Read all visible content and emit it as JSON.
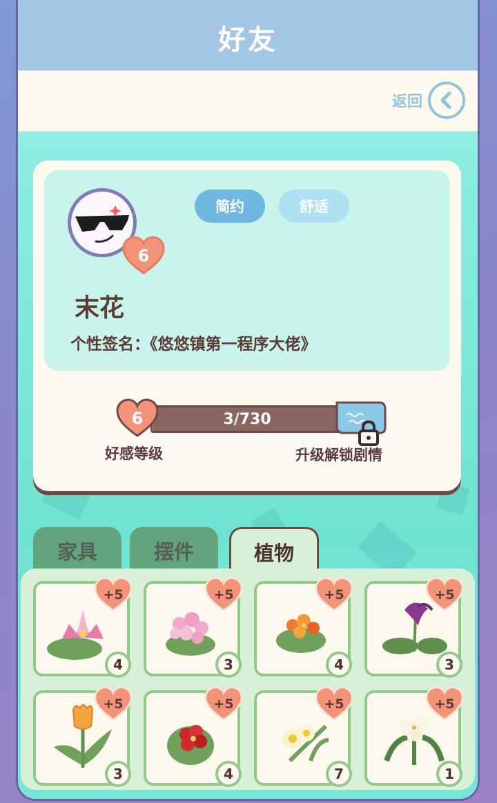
{
  "header": {
    "title": "好友"
  },
  "back": {
    "label": "返回",
    "icon": "chevron-left-icon"
  },
  "profile": {
    "level": "6",
    "name": "末花",
    "signature": "个性签名：《悠悠镇第一程序大佬》",
    "tags": [
      "简约",
      "舒适"
    ]
  },
  "affinity": {
    "level": "6",
    "progress_text": "3/730",
    "progress_current": 3,
    "progress_max": 730,
    "level_label": "好感等级",
    "unlock_label": "升级解锁剧情",
    "unlock_icon": "lock-icon"
  },
  "tabs": [
    {
      "label": "家具",
      "active": false
    },
    {
      "label": "摆件",
      "active": false
    },
    {
      "label": "植物",
      "active": true
    }
  ],
  "items": [
    {
      "icon": "lotus-icon",
      "bonus": "+5",
      "count": "4"
    },
    {
      "icon": "pink-hydrangea-icon",
      "bonus": "+5",
      "count": "3"
    },
    {
      "icon": "orange-flower-icon",
      "bonus": "+5",
      "count": "4"
    },
    {
      "icon": "purple-orchid-icon",
      "bonus": "+5",
      "count": "3"
    },
    {
      "icon": "tulip-icon",
      "bonus": "+5",
      "count": "3"
    },
    {
      "icon": "red-primrose-icon",
      "bonus": "+5",
      "count": "4"
    },
    {
      "icon": "daffodil-icon",
      "bonus": "+5",
      "count": "7"
    },
    {
      "icon": "white-lily-icon",
      "bonus": "+5",
      "count": "1"
    }
  ],
  "colors": {
    "header": "#a3c6e6",
    "panel_teal": "#7fe8d8",
    "cream": "#fdf9ee",
    "heart": "#f3947a",
    "text_brown": "#5a3b38",
    "tag_active": "#6fb9e0",
    "tag_inactive": "#aee2f3"
  }
}
